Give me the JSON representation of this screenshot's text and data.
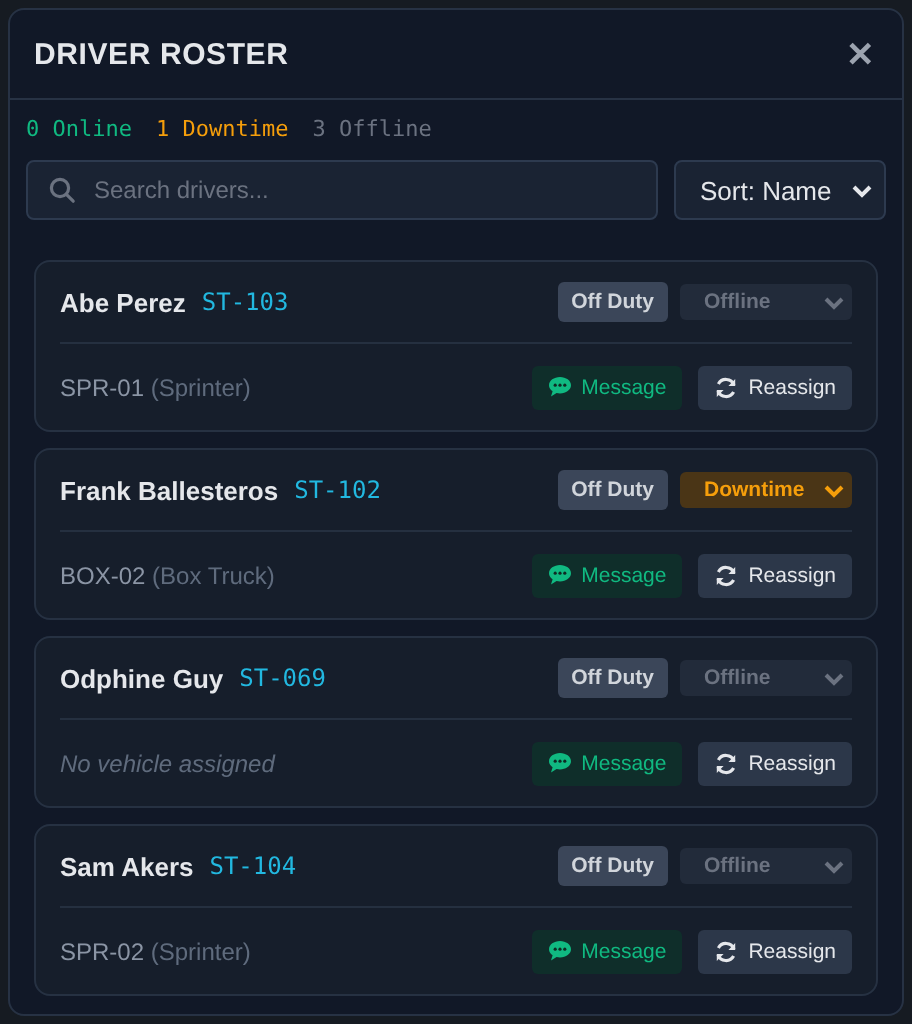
{
  "title": "DRIVER ROSTER",
  "close": "✕",
  "counts": [
    {
      "label": "0 Online",
      "kind": "online"
    },
    {
      "label": "1 Downtime",
      "kind": "downtime"
    },
    {
      "label": "3 Offline",
      "kind": "offline"
    }
  ],
  "search": {
    "placeholder": "Search drivers..."
  },
  "sort": {
    "value": "Sort: Name"
  },
  "drivers": [
    {
      "name": "Abe Perez",
      "id": "ST-103",
      "duty": "Off Duty",
      "status": {
        "label": "Offline",
        "kind": "offline"
      },
      "vehicle": {
        "code": "SPR-01",
        "type": "(Sprinter)"
      },
      "message": "Message",
      "reassign": "Reassign"
    },
    {
      "name": "Frank Ballesteros",
      "id": "ST-102",
      "duty": "Off Duty",
      "status": {
        "label": "Downtime",
        "kind": "downtime"
      },
      "vehicle": {
        "code": "BOX-02",
        "type": "(Box Truck)"
      },
      "message": "Message",
      "reassign": "Reassign"
    },
    {
      "name": "Odphine Guy",
      "id": "ST-069",
      "duty": "Off Duty",
      "status": {
        "label": "Offline",
        "kind": "offline"
      },
      "no_vehicle": "No vehicle assigned",
      "message": "Message",
      "reassign": "Reassign"
    },
    {
      "name": "Sam Akers",
      "id": "ST-104",
      "duty": "Off Duty",
      "status": {
        "label": "Offline",
        "kind": "offline"
      },
      "vehicle": {
        "code": "SPR-02",
        "type": "(Sprinter)"
      },
      "message": "Message",
      "reassign": "Reassign"
    }
  ]
}
